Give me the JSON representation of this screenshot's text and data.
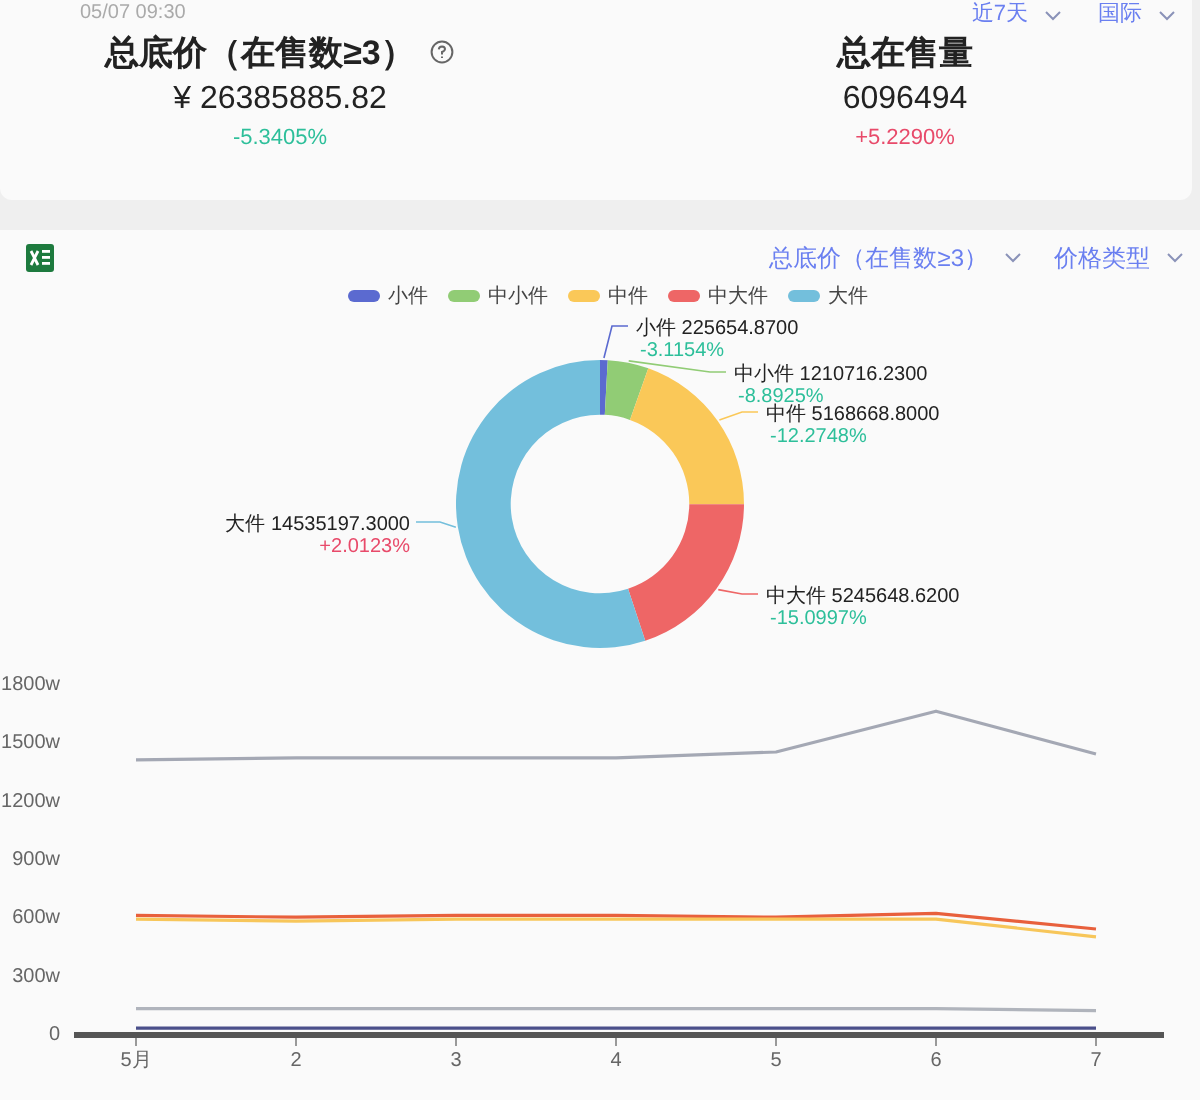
{
  "header": {
    "timestamp": "05/07 09:30",
    "filters": [
      {
        "label": "近7天"
      },
      {
        "label": "国际"
      }
    ]
  },
  "stats": [
    {
      "title": "总底价（在售数≥3）",
      "has_help": true,
      "value": "¥ 26385885.82",
      "change": {
        "text": "-5.3405%",
        "color": "#2dbf9a"
      }
    },
    {
      "title": "总在售量",
      "value": "6096494",
      "change": {
        "text": "+5.2290%",
        "color": "#e84a6a"
      }
    }
  ],
  "toolbar": {
    "dropdowns": [
      {
        "label": "总底价（在售数≥3）"
      },
      {
        "label": "价格类型"
      }
    ]
  },
  "donut": {
    "chart_data": {
      "type": "donut",
      "categories": [
        "小件",
        "中小件",
        "中件",
        "中大件",
        "大件"
      ],
      "values": [
        225654.87,
        1210716.23,
        5168668.8,
        5245648.62,
        14535197.3
      ],
      "colors": [
        "#5b6ad0",
        "#91cc75",
        "#fac858",
        "#ee6666",
        "#73bfdc"
      ],
      "value_labels": [
        "225654.8700",
        "1210716.2300",
        "5168668.8000",
        "5245648.6200",
        "14535197.3000"
      ]
    },
    "slice_changes": [
      {
        "text": "-3.1154%",
        "color": "#2dbf9a"
      },
      {
        "text": "-8.8925%",
        "color": "#2dbf9a"
      },
      {
        "text": "-12.2748%",
        "color": "#2dbf9a"
      },
      {
        "text": "-15.0997%",
        "color": "#2dbf9a"
      },
      {
        "text": "+2.0123%",
        "color": "#e84a6a"
      }
    ]
  },
  "trend_chart": {
    "chart_data": {
      "type": "line",
      "categories": [
        "5月",
        "2",
        "3",
        "4",
        "5",
        "6",
        "7"
      ],
      "ylim": [
        0,
        1800
      ],
      "yticks": [
        {
          "value": 0,
          "label": "0"
        },
        {
          "value": 300,
          "label": "300w"
        },
        {
          "value": 600,
          "label": "600w"
        },
        {
          "value": 900,
          "label": "900w"
        },
        {
          "value": 1200,
          "label": "1200w"
        },
        {
          "value": 1500,
          "label": "1500w"
        },
        {
          "value": 1800,
          "label": "1800w"
        }
      ],
      "series": [
        {
          "color": "#a4a8b4",
          "values": [
            1400,
            1410,
            1410,
            1410,
            1440,
            1650,
            1430
          ]
        },
        {
          "color": "#e8603c",
          "values": [
            600,
            590,
            600,
            600,
            590,
            610,
            530
          ]
        },
        {
          "color": "#f7c65a",
          "values": [
            580,
            570,
            580,
            580,
            580,
            580,
            490
          ]
        },
        {
          "color": "#b0b4bc",
          "values": [
            120,
            120,
            120,
            120,
            120,
            120,
            110
          ]
        },
        {
          "color": "#4a4f8a",
          "values": [
            20,
            20,
            20,
            20,
            20,
            20,
            20
          ]
        }
      ]
    }
  }
}
